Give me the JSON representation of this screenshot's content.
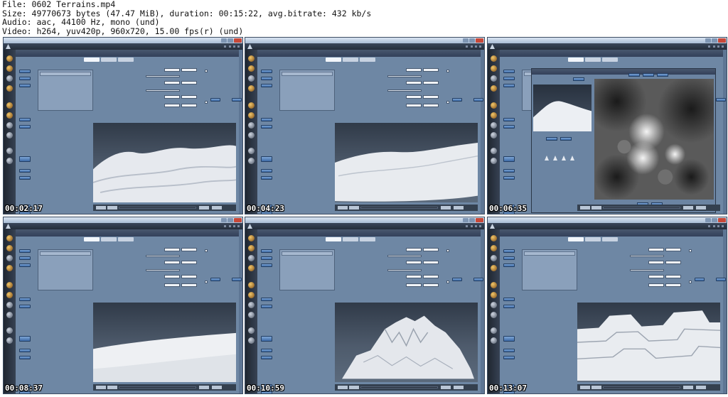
{
  "header": {
    "file": "File: 0602 Terrains.mp4",
    "size": "Size: 49770673 bytes (47.47 MiB), duration: 00:15:22, avg.bitrate: 432 kb/s",
    "audio": "Audio: aac, 44100 Hz, mono (und)",
    "video": "Video: h264, yuv420p, 960x720, 15.00 fps(r) (und)"
  },
  "frames": [
    {
      "timestamp": "00:02:17"
    },
    {
      "timestamp": "00:04:23"
    },
    {
      "timestamp": "00:06:35"
    },
    {
      "timestamp": "00:08:37"
    },
    {
      "timestamp": "00:10:59"
    },
    {
      "timestamp": "00:13:07"
    }
  ],
  "colors": {
    "app_background": "#6e87a4",
    "menubar": "#2a3442",
    "button": "#4f7fbf",
    "terrain": "#e6e9ee"
  }
}
